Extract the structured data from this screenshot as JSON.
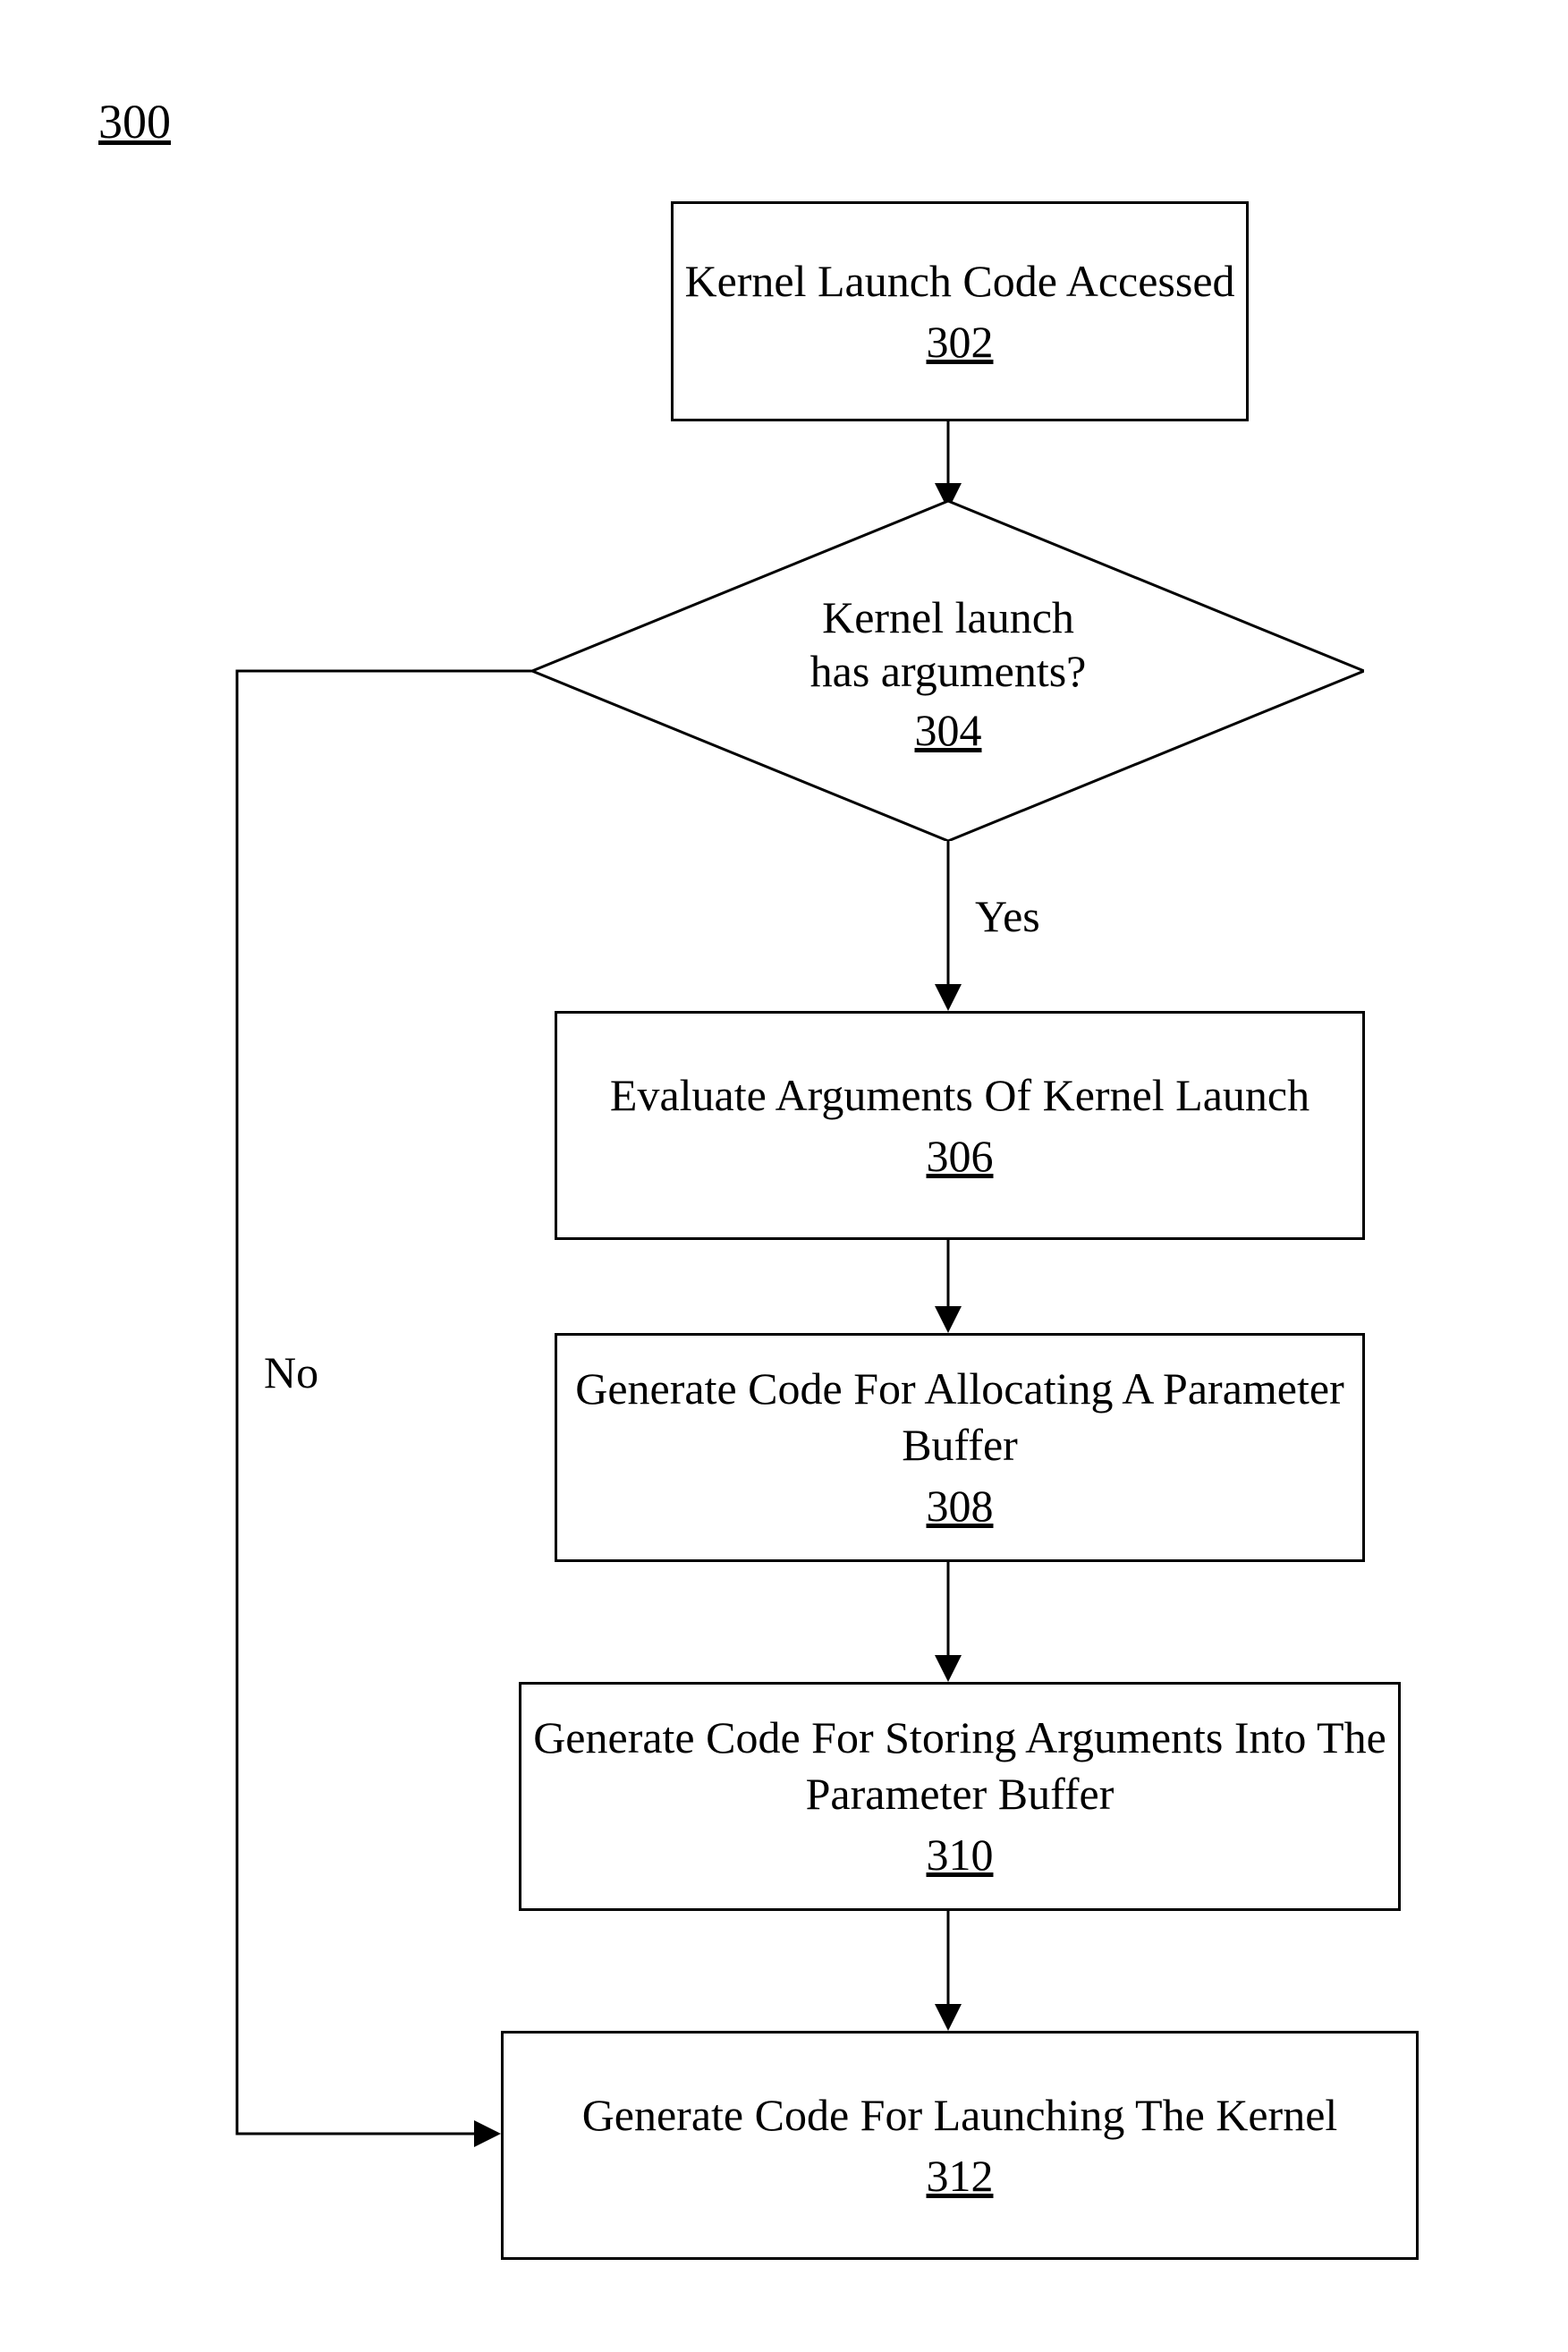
{
  "figure_number": "300",
  "steps": {
    "s302": {
      "text": "Kernel Launch Code Accessed",
      "ref": "302"
    },
    "s304": {
      "text_l1": "Kernel launch",
      "text_l2": "has arguments?",
      "ref": "304"
    },
    "s306": {
      "text": "Evaluate Arguments Of Kernel Launch",
      "ref": "306"
    },
    "s308": {
      "text": "Generate Code For Allocating A Parameter Buffer",
      "ref": "308"
    },
    "s310": {
      "text": "Generate Code For Storing Arguments Into The Parameter Buffer",
      "ref": "310"
    },
    "s312": {
      "text": "Generate Code For Launching The Kernel",
      "ref": "312"
    }
  },
  "labels": {
    "yes": "Yes",
    "no": "No"
  }
}
